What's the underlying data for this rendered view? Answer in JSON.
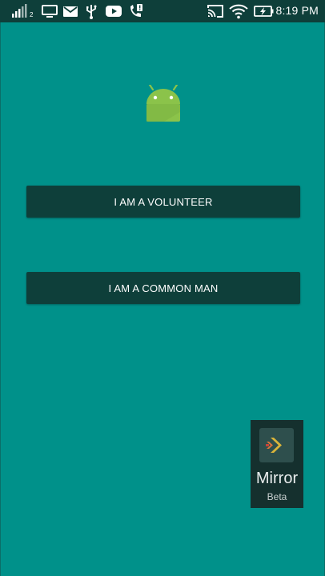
{
  "status_bar": {
    "sim_slot": "2",
    "time": "8:19 PM",
    "icons": [
      "signal-icon",
      "monitor-icon",
      "mail-icon",
      "usb-icon",
      "youtube-icon",
      "phone-alert-icon",
      "cast-icon",
      "wifi-icon",
      "battery-charging-icon"
    ]
  },
  "main": {
    "logo": "android-logo",
    "buttons": {
      "volunteer_label": "I AM A VOLUNTEER",
      "common_man_label": "I AM A COMMON MAN"
    }
  },
  "mirror_widget": {
    "title": "Mirror",
    "subtitle": "Beta"
  },
  "colors": {
    "background": "#00918a",
    "status_bar": "#0e3f3a",
    "button": "#0e3f3a",
    "android_green": "#8bc34a"
  }
}
